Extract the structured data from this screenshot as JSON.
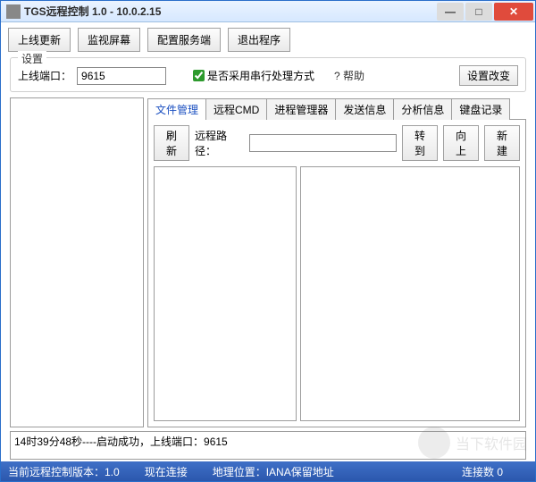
{
  "window": {
    "title": "TGS远程控制 1.0 - 10.0.2.15"
  },
  "toolbar": {
    "update": "上线更新",
    "monitor": "监视屏幕",
    "config": "配置服务端",
    "exit": "退出程序"
  },
  "settings": {
    "legend": "设置",
    "port_label": "上线端口：",
    "port_value": "9615",
    "serial_label": "是否采用串行处理方式",
    "help": "? 帮助",
    "apply": "设置改变"
  },
  "tabs": {
    "file": "文件管理",
    "cmd": "远程CMD",
    "proc": "进程管理器",
    "send": "发送信息",
    "analyze": "分析信息",
    "keylog": "键盘记录"
  },
  "file_mgr": {
    "refresh": "刷新",
    "path_label": "远程路径：",
    "path_value": "",
    "go": "转到",
    "up": "向上",
    "new": "新建"
  },
  "log": {
    "line1": "14时39分48秒----启动成功，上线端口：9615"
  },
  "status": {
    "version": "当前远程控制版本：1.0",
    "conn": "现在连接",
    "geo": "地理位置：IANA保留地址",
    "count": "连接数 0"
  },
  "watermark": {
    "text": "当下软件园"
  }
}
